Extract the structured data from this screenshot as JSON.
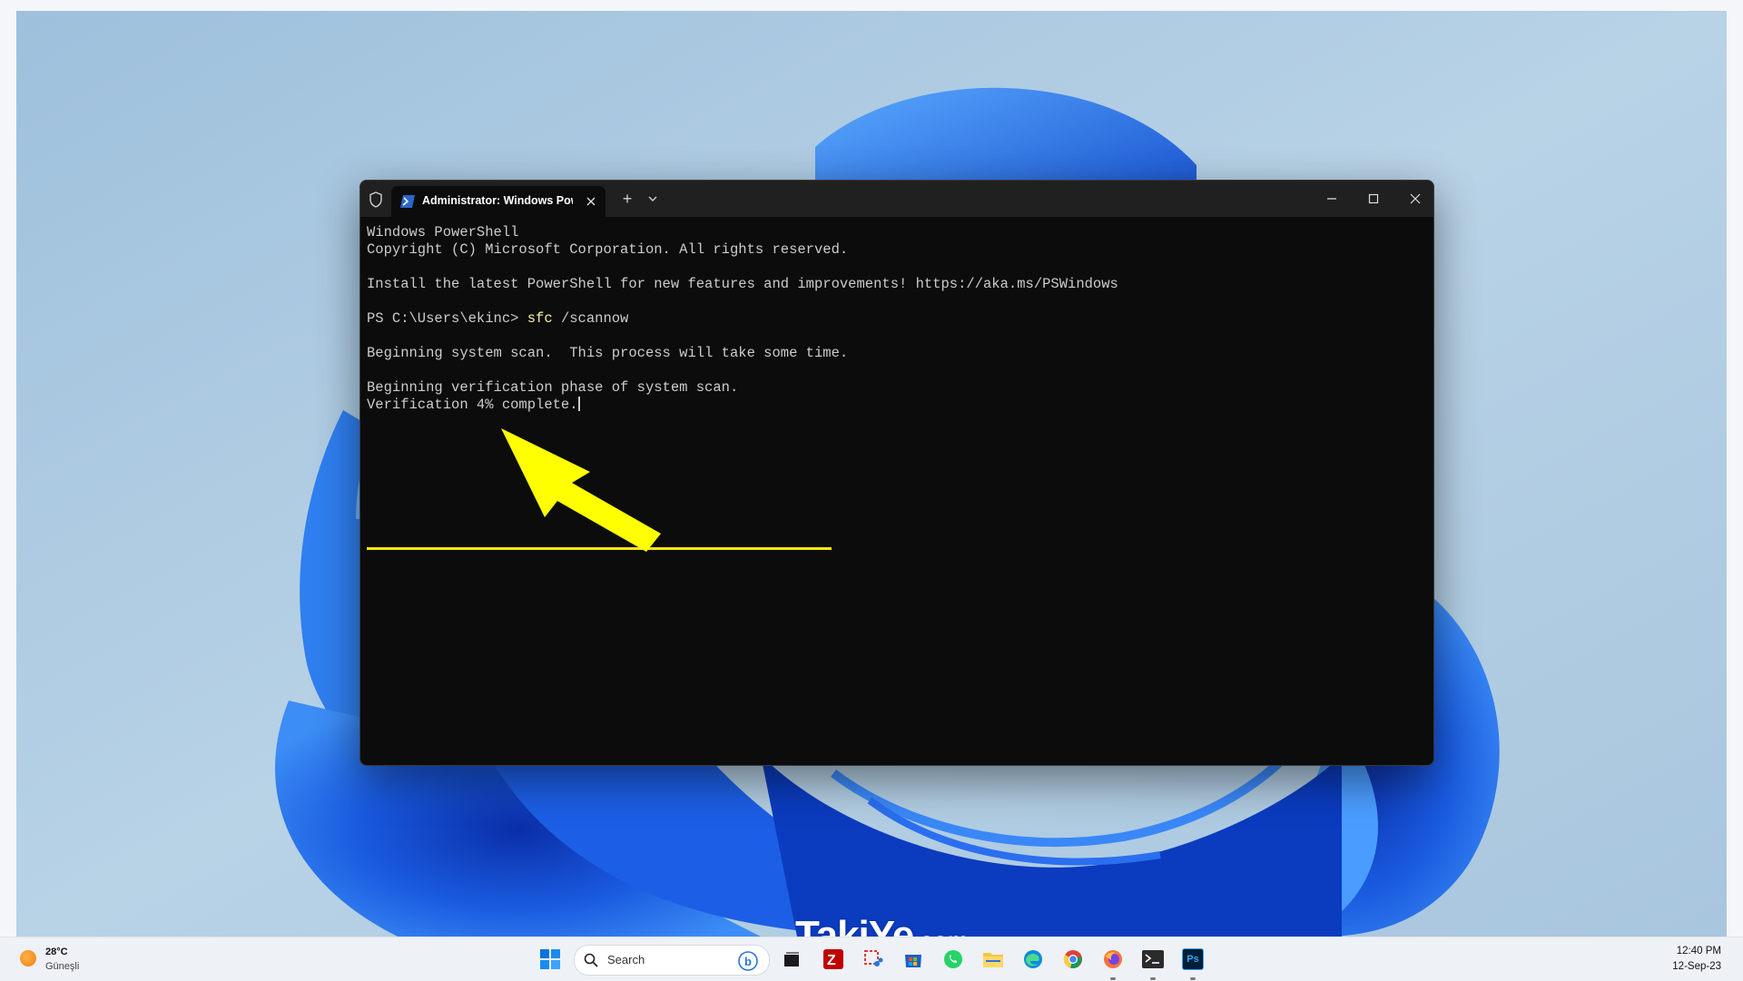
{
  "window": {
    "tab_title": "Administrator: Windows Powe",
    "new_tab_symbol": "+",
    "console_lines": [
      "Windows PowerShell",
      "Copyright (C) Microsoft Corporation. All rights reserved.",
      "",
      "Install the latest PowerShell for new features and improvements! https://aka.ms/PSWindows",
      "",
      "",
      "",
      "Beginning system scan.  This process will take some time.",
      "",
      "Beginning verification phase of system scan.",
      "Verification 4% complete."
    ],
    "prompt": "PS C:\\Users\\ekinc> ",
    "command": "sfc",
    "command_args": " /scannow",
    "colors": {
      "background": "#0c0c0c",
      "text": "#cccccc",
      "command": "#f9f1a5",
      "highlight": "#f6e90f"
    }
  },
  "annotation": {
    "arrow_color": "#ffff00",
    "highlighted_line": "Beginning system scan.  This process will take some time."
  },
  "watermark": {
    "main": "TakiYe",
    "suffix": ".com"
  },
  "taskbar": {
    "weather": {
      "temperature": "28°C",
      "condition": "Güneşli",
      "icon": "sun-icon"
    },
    "search_placeholder": "Search",
    "apps": [
      "start-icon",
      "task-view-icon",
      "filezilla-icon",
      "snipping-tool-icon",
      "microsoft-store-icon",
      "whatsapp-icon",
      "file-explorer-icon",
      "edge-icon",
      "chrome-icon",
      "firefox-icon",
      "terminal-icon",
      "photoshop-icon"
    ],
    "photoshop_label": "Ps",
    "clock": {
      "time": "12:40 PM",
      "date": "12-Sep-23"
    }
  }
}
